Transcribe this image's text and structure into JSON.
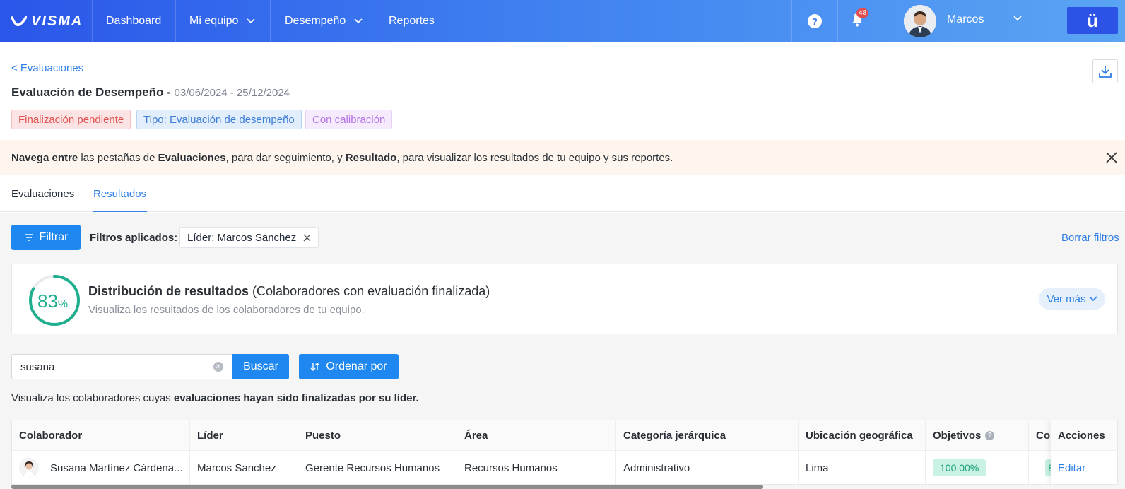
{
  "topbar": {
    "logo_text": "VISMA",
    "nav": {
      "dashboard": "Dashboard",
      "team": "Mi equipo",
      "performance": "Desempeño",
      "reports": "Reportes"
    },
    "notifications_count": "48",
    "help_glyph": "?",
    "user_name": "Marcos",
    "app_logo": "ü",
    "brand_color": "#2a56e9"
  },
  "header": {
    "back_link": "< Evaluaciones",
    "title": "Evaluación de Desempeño -",
    "dates": "03/06/2024 - 25/12/2024",
    "tags": {
      "status": "Finalización pendiente",
      "type": "Tipo: Evaluación de desempeño",
      "calibration": "Con calibración"
    }
  },
  "banner": {
    "part1_bold": "Navega entre",
    "part2": " las pestañas de ",
    "part3_bold": "Evaluaciones",
    "part4": ", para dar seguimiento, y ",
    "part5_bold": "Resultado",
    "part6": ", para visualizar los resultados de tu equipo y sus reportes."
  },
  "tabs": {
    "evaluations": "Evaluaciones",
    "results": "Resultados",
    "active": "results"
  },
  "filters": {
    "button": "Filtrar",
    "applied_label": "Filtros aplicados:",
    "chip": "Líder: Marcos Sanchez",
    "clear": "Borrar filtros"
  },
  "distribution": {
    "percent_value": 83,
    "percent_number": "83",
    "percent_sign": "%",
    "title_bold": "Distribución de resultados",
    "title_rest": " (Colaboradores con evaluación finalizada)",
    "subtitle": "Visualiza los resultados de los colaboradores de tu equipo.",
    "see_more": "Ver más"
  },
  "search": {
    "value": "susana",
    "button": "Buscar",
    "order_button": "Ordenar por"
  },
  "hint": {
    "part1": "Visualiza los colaboradores cuyas ",
    "part2_bold": "evaluaciones hayan sido finalizadas por su líder."
  },
  "table": {
    "headers": {
      "collaborator": "Colaborador",
      "leader": "Líder",
      "position": "Puesto",
      "area": "Área",
      "category": "Categoría jerárquica",
      "location": "Ubicación geográfica",
      "objectives": "Objetivos",
      "partial": "Co",
      "actions": "Acciones"
    },
    "rows": [
      {
        "collaborator": "Susana Martínez Cárdena...",
        "leader": "Marcos Sanchez",
        "position": "Gerente Recursos Humanos",
        "area": "Recursos Humanos",
        "category": "Administrativo",
        "location": "Lima",
        "objectives": "100.00%",
        "partial": "8",
        "action": "Editar"
      }
    ]
  }
}
